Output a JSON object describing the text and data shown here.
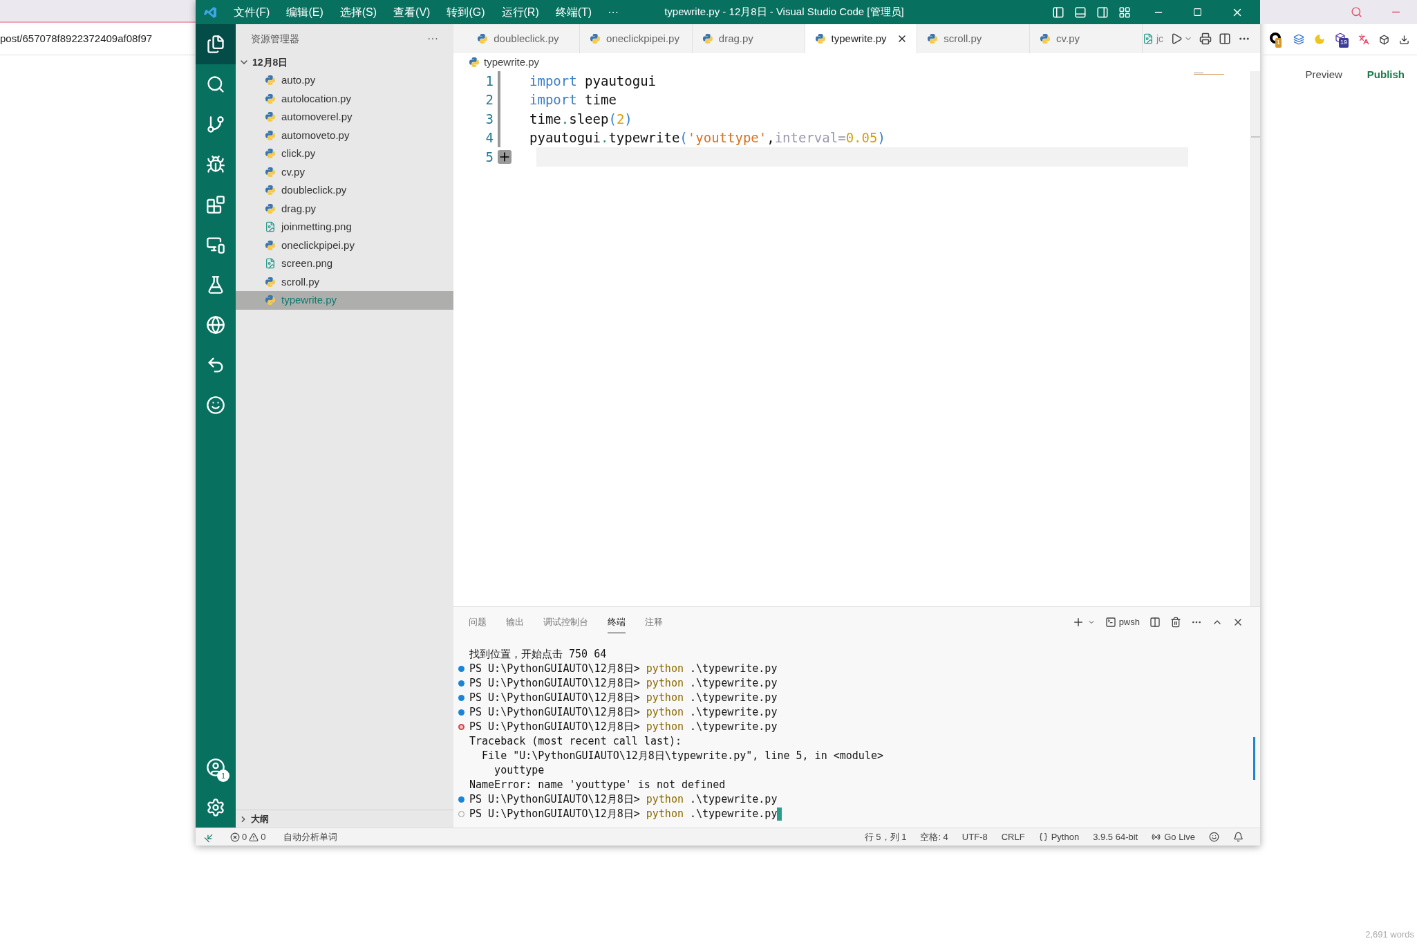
{
  "browser_left": {
    "url": "post/657078f8922372409af08f97"
  },
  "browser_right": {
    "extension_badges": [
      "1",
      "19"
    ],
    "actions": [
      {
        "label": "Preview",
        "kind": "plain"
      },
      {
        "label": "Publish",
        "kind": "primary"
      }
    ],
    "word_count": "2,691 words"
  },
  "title_bar": {
    "menus": [
      "文件(F)",
      "编辑(E)",
      "选择(S)",
      "查看(V)",
      "转到(G)",
      "运行(R)",
      "终端(T)"
    ],
    "more": "···",
    "title": "typewrite.py - 12月8日 - Visual Studio Code [管理员]"
  },
  "activity_bar": {
    "account_badge": "1"
  },
  "sidebar": {
    "title": "资源管理器",
    "more": "···",
    "folder": {
      "name": "12月8日",
      "expanded": true
    },
    "files": [
      {
        "name": "auto.py",
        "kind": "python",
        "selected": false
      },
      {
        "name": "autolocation.py",
        "kind": "python",
        "selected": false
      },
      {
        "name": "automoverel.py",
        "kind": "python",
        "selected": false
      },
      {
        "name": "automoveto.py",
        "kind": "python",
        "selected": false
      },
      {
        "name": "click.py",
        "kind": "python",
        "selected": false
      },
      {
        "name": "cv.py",
        "kind": "python",
        "selected": false
      },
      {
        "name": "doubleclick.py",
        "kind": "python",
        "selected": false
      },
      {
        "name": "drag.py",
        "kind": "python",
        "selected": false
      },
      {
        "name": "joinmetting.png",
        "kind": "image",
        "selected": false
      },
      {
        "name": "oneclickpipei.py",
        "kind": "python",
        "selected": false
      },
      {
        "name": "screen.png",
        "kind": "image",
        "selected": false
      },
      {
        "name": "scroll.py",
        "kind": "python",
        "selected": false
      },
      {
        "name": "typewrite.py",
        "kind": "python",
        "selected": true
      }
    ],
    "outline": {
      "label": "大纲",
      "expanded": false
    }
  },
  "tabs": [
    {
      "label": "doubleclick.py",
      "selected": false
    },
    {
      "label": "oneclickpipei.py",
      "selected": false
    },
    {
      "label": "drag.py",
      "selected": false
    },
    {
      "label": "typewrite.py",
      "selected": true
    },
    {
      "label": "scroll.py",
      "selected": false
    },
    {
      "label": "cv.py",
      "selected": false
    }
  ],
  "tab_overflow": "jc",
  "editor": {
    "breadcrumb": "typewrite.py",
    "lines": [
      {
        "number": "1",
        "current": false,
        "tokens": [
          {
            "text": "import",
            "kind": "keyword"
          },
          {
            "text": " pyautogui",
            "kind": "plain"
          }
        ]
      },
      {
        "number": "2",
        "current": false,
        "tokens": [
          {
            "text": "import",
            "kind": "keyword"
          },
          {
            "text": " time",
            "kind": "plain"
          }
        ]
      },
      {
        "number": "3",
        "current": false,
        "tokens": [
          {
            "text": "time",
            "kind": "plain"
          },
          {
            "text": ".",
            "kind": "dot"
          },
          {
            "text": "sleep",
            "kind": "plain"
          },
          {
            "text": "(",
            "kind": "paren"
          },
          {
            "text": "2",
            "kind": "number"
          },
          {
            "text": ")",
            "kind": "paren"
          }
        ]
      },
      {
        "number": "4",
        "current": false,
        "tokens": [
          {
            "text": "pyautogui",
            "kind": "plain"
          },
          {
            "text": ".",
            "kind": "dot"
          },
          {
            "text": "typewrite",
            "kind": "plain"
          },
          {
            "text": "(",
            "kind": "paren"
          },
          {
            "text": "'youttype'",
            "kind": "string"
          },
          {
            "text": ",",
            "kind": "plain"
          },
          {
            "text": "interval",
            "kind": "param"
          },
          {
            "text": "=",
            "kind": "param"
          },
          {
            "text": "0.05",
            "kind": "number"
          },
          {
            "text": ")",
            "kind": "paren"
          }
        ]
      },
      {
        "number": "5",
        "current": true
      }
    ]
  },
  "panel": {
    "tabs": [
      {
        "label": "问题",
        "selected": false
      },
      {
        "label": "输出",
        "selected": false
      },
      {
        "label": "调试控制台",
        "selected": false
      },
      {
        "label": "终端",
        "selected": true
      },
      {
        "label": "注释",
        "selected": false
      }
    ],
    "shell": "pwsh",
    "terminal": [
      {
        "kind": "text",
        "text": "找到位置，开始点击 750 64"
      },
      {
        "kind": "prompt",
        "finished": true,
        "failed": false,
        "prompt": "PS U:\\PythonGUIAUTO\\12月8日> ",
        "command": "python",
        "args": " .\\typewrite.py",
        "cursor": false
      },
      {
        "kind": "prompt",
        "finished": true,
        "failed": false,
        "prompt": "PS U:\\PythonGUIAUTO\\12月8日> ",
        "command": "python",
        "args": " .\\typewrite.py",
        "cursor": false
      },
      {
        "kind": "prompt",
        "finished": true,
        "failed": false,
        "prompt": "PS U:\\PythonGUIAUTO\\12月8日> ",
        "command": "python",
        "args": " .\\typewrite.py",
        "cursor": false
      },
      {
        "kind": "prompt",
        "finished": true,
        "failed": false,
        "prompt": "PS U:\\PythonGUIAUTO\\12月8日> ",
        "command": "python",
        "args": " .\\typewrite.py",
        "cursor": false
      },
      {
        "kind": "prompt",
        "finished": true,
        "failed": true,
        "prompt": "PS U:\\PythonGUIAUTO\\12月8日> ",
        "command": "python",
        "args": " .\\typewrite.py",
        "cursor": false
      },
      {
        "kind": "text",
        "text": "Traceback (most recent call last):"
      },
      {
        "kind": "text",
        "text": "  File \"U:\\PythonGUIAUTO\\12月8日\\typewrite.py\", line 5, in <module>"
      },
      {
        "kind": "text",
        "text": "    youttype"
      },
      {
        "kind": "text",
        "text": "NameError: name 'youttype' is not defined"
      },
      {
        "kind": "prompt",
        "finished": true,
        "failed": false,
        "prompt": "PS U:\\PythonGUIAUTO\\12月8日> ",
        "command": "python",
        "args": " .\\typewrite.py",
        "cursor": false
      },
      {
        "kind": "prompt",
        "finished": false,
        "prompt": "PS U:\\PythonGUIAUTO\\12月8日> ",
        "command": "python",
        "args": " .\\typewrite.py",
        "cursor": true
      }
    ]
  },
  "status_bar": {
    "errors": "0",
    "warnings": "0",
    "analysis": "自动分析单词",
    "items": [
      {
        "label": "行 5，列 1",
        "kind": "text"
      },
      {
        "label": "空格: 4",
        "kind": "text"
      },
      {
        "label": "UTF-8",
        "kind": "text"
      },
      {
        "label": "CRLF",
        "kind": "text"
      },
      {
        "label": "Python",
        "kind": "language"
      },
      {
        "label": "3.9.5 64-bit",
        "kind": "text"
      },
      {
        "label": "Go Live",
        "kind": "live"
      }
    ]
  }
}
